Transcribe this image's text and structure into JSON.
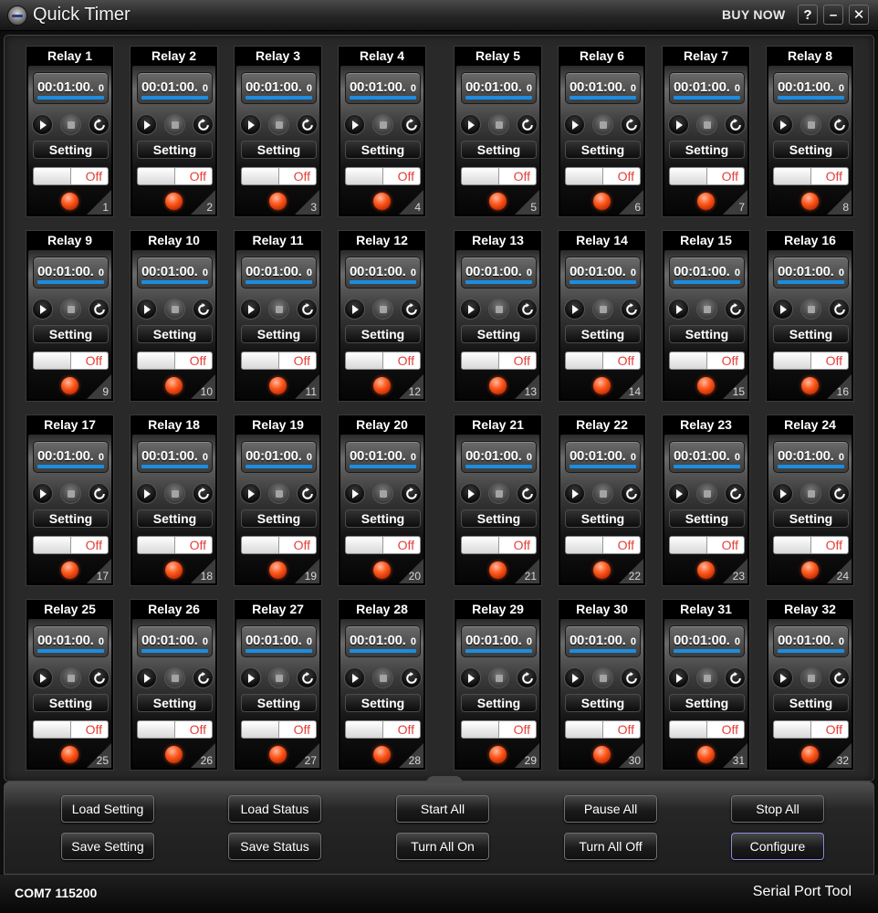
{
  "window": {
    "title": "Quick Timer",
    "buy_now": "BUY NOW",
    "help_label": "?",
    "minimize_label": "–",
    "close_label": "✕"
  },
  "relay_defaults": {
    "time": "00:01:00.",
    "tenths": "0",
    "setting_label": "Setting",
    "switch_state": "Off",
    "progress": 1.0,
    "indicator_color": "#ff5a1e",
    "progress_color": "#1c8de0"
  },
  "relays": [
    {
      "name": "Relay 1",
      "number": "1"
    },
    {
      "name": "Relay 2",
      "number": "2"
    },
    {
      "name": "Relay 3",
      "number": "3"
    },
    {
      "name": "Relay 4",
      "number": "4"
    },
    {
      "name": "Relay 5",
      "number": "5"
    },
    {
      "name": "Relay 6",
      "number": "6"
    },
    {
      "name": "Relay 7",
      "number": "7"
    },
    {
      "name": "Relay 8",
      "number": "8"
    },
    {
      "name": "Relay 9",
      "number": "9"
    },
    {
      "name": "Relay 10",
      "number": "10"
    },
    {
      "name": "Relay 11",
      "number": "11"
    },
    {
      "name": "Relay 12",
      "number": "12"
    },
    {
      "name": "Relay 13",
      "number": "13"
    },
    {
      "name": "Relay 14",
      "number": "14"
    },
    {
      "name": "Relay 15",
      "number": "15"
    },
    {
      "name": "Relay 16",
      "number": "16"
    },
    {
      "name": "Relay 17",
      "number": "17"
    },
    {
      "name": "Relay 18",
      "number": "18"
    },
    {
      "name": "Relay 19",
      "number": "19"
    },
    {
      "name": "Relay 20",
      "number": "20"
    },
    {
      "name": "Relay 21",
      "number": "21"
    },
    {
      "name": "Relay 22",
      "number": "22"
    },
    {
      "name": "Relay 23",
      "number": "23"
    },
    {
      "name": "Relay 24",
      "number": "24"
    },
    {
      "name": "Relay 25",
      "number": "25"
    },
    {
      "name": "Relay 26",
      "number": "26"
    },
    {
      "name": "Relay 27",
      "number": "27"
    },
    {
      "name": "Relay 28",
      "number": "28"
    },
    {
      "name": "Relay 29",
      "number": "29"
    },
    {
      "name": "Relay 30",
      "number": "30"
    },
    {
      "name": "Relay 31",
      "number": "31"
    },
    {
      "name": "Relay 32",
      "number": "32"
    }
  ],
  "controls": {
    "load_setting": "Load Setting",
    "load_status": "Load Status",
    "start_all": "Start All",
    "pause_all": "Pause All",
    "stop_all": "Stop All",
    "save_setting": "Save Setting",
    "save_status": "Save Status",
    "turn_all_on": "Turn All On",
    "turn_all_off": "Turn All Off",
    "configure": "Configure"
  },
  "status_bar": {
    "port": "COM7 115200",
    "tool_link": "Serial Port Tool"
  }
}
